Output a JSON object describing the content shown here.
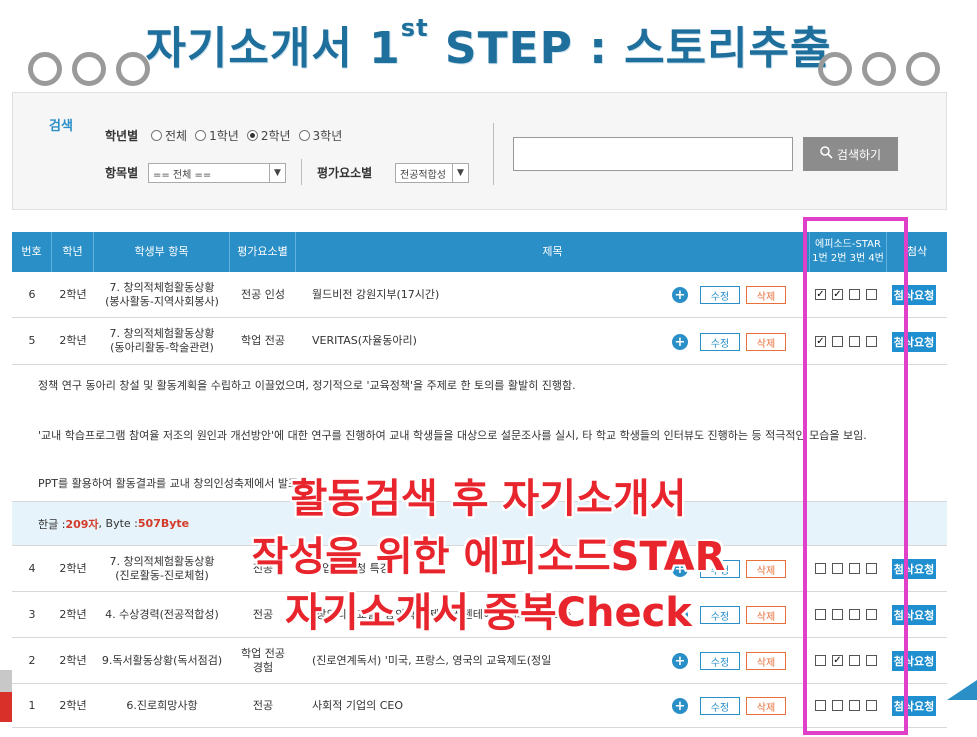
{
  "slide": {
    "title_main": "자기소개서 1",
    "title_sup": "st",
    "title_rest": " STEP : 스토리추출"
  },
  "search": {
    "label": "검색",
    "grade_label": "학년별",
    "grade_options": [
      "전체",
      "1학년",
      "2학년",
      "3학년"
    ],
    "grade_selected": "2학년",
    "item_label": "항목별",
    "item_select": "== 전체 ==",
    "eval_label": "평가요소별",
    "eval_select": "전공적합성",
    "input_placeholder": "",
    "button_label": "검색하기"
  },
  "table": {
    "headers": {
      "no": "번호",
      "grade": "학년",
      "category": "학생부 항목",
      "eval": "평가요소별",
      "title": "제목",
      "star_top": "에피소드-STAR",
      "star_bottom": "1번 2번 3번 4번",
      "review": "첨삭"
    },
    "edit_label": "수정",
    "delete_label": "삭제",
    "request_label": "첨삭요청",
    "rows": [
      {
        "no": "6",
        "grade": "2학년",
        "category": "7. 창의적체험활동상황\n(봉사활동-지역사회봉사)",
        "eval": "전공 인성",
        "title": "월드비전 강원지부(17시간)",
        "checks": [
          true,
          true,
          false,
          false
        ]
      },
      {
        "no": "5",
        "grade": "2학년",
        "category": "7. 창의적체험활동상황\n(동아리활동-학술관련)",
        "eval": "학업 전공",
        "title": "VERITAS(자율동아리)",
        "checks": [
          true,
          false,
          false,
          false
        ]
      },
      {
        "no": "4",
        "grade": "2학년",
        "category": "7. 창의적체험활동상황\n(진로활동-진로체험)",
        "eval": "전공",
        "title": "직업인 초청 특강",
        "checks": [
          false,
          false,
          false,
          false
        ]
      },
      {
        "no": "3",
        "grade": "2학년",
        "category": "4. 수상경력(전공적합성)",
        "eval": "전공",
        "title": "[창의리더교실] 창의적 주제 프레젠테이션 대회 공동 3등",
        "checks": [
          false,
          false,
          false,
          false
        ]
      },
      {
        "no": "2",
        "grade": "2학년",
        "category": "9.독서활동상황(독서점검)",
        "eval": "학업 전공\n경험",
        "title": "(진로연계독서) '미국, 프랑스, 영국의 교육제도(정일",
        "checks": [
          false,
          true,
          false,
          false
        ]
      },
      {
        "no": "1",
        "grade": "2학년",
        "category": "6.진로희망사항",
        "eval": "전공",
        "title": "사회적 기업의 CEO",
        "checks": [
          false,
          false,
          false,
          false
        ]
      }
    ]
  },
  "detail": {
    "line1": "정책 연구 동아리 창설 및 활동계획을 수립하고 이끌었으며, 정기적으로 '교육정책'을 주제로 한 토의를 활발히 진행함.",
    "line2": "'교내 학습프로그램 참여율 저조의 원인과 개선방안'에 대한 연구를 진행하여 교내 학생들을 대상으로 설문조사를 실시, 타 학교 학생들의 인터뷰도 진행하는 등 적극적인 모습을 보임.",
    "line3": "PPT를 활용하여 활동결과를 교내 창의인성축제에서 발표함.",
    "hangul_label": "한글 : ",
    "hangul_value": "209자",
    "byte_label": ", Byte : ",
    "byte_value": "507Byte"
  },
  "overlay": {
    "line1": "활동검색 후 자기소개서",
    "line2": "작성을 위한 에피소드STAR",
    "line3": "자기소개서 중복Check"
  },
  "colors": {
    "primary": "#2a8fc7",
    "overlay_red": "#e8242c",
    "highlight_magenta": "#e040c8",
    "delete_orange": "#e8703a"
  }
}
